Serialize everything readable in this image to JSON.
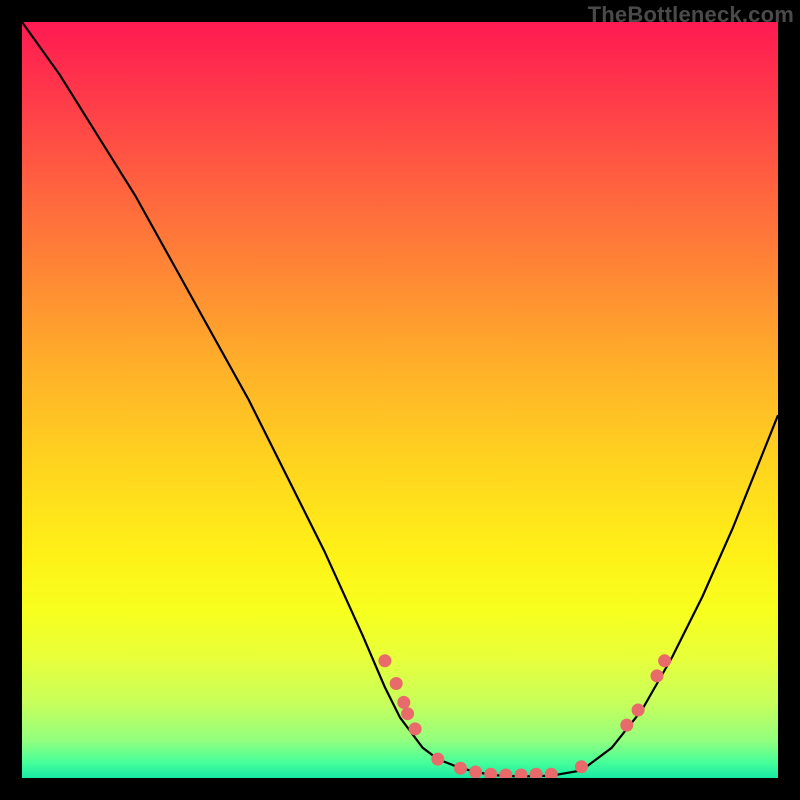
{
  "watermark": "TheBottleneck.com",
  "chart_data": {
    "type": "line",
    "title": "",
    "xlabel": "",
    "ylabel": "",
    "xlim": [
      0,
      100
    ],
    "ylim": [
      0,
      100
    ],
    "grid": false,
    "series": [
      {
        "name": "curve",
        "x": [
          0,
          5,
          10,
          15,
          20,
          25,
          30,
          35,
          40,
          45,
          48,
          50,
          53,
          55,
          58,
          62,
          66,
          70,
          74,
          78,
          82,
          86,
          90,
          94,
          98,
          100
        ],
        "y": [
          100,
          93,
          85,
          77,
          68,
          59,
          50,
          40,
          30,
          19,
          12,
          8,
          4,
          2.5,
          1.3,
          0.4,
          0.2,
          0.3,
          1,
          4,
          9,
          16,
          24,
          33,
          43,
          48
        ]
      }
    ],
    "markers": [
      {
        "x": 48.0,
        "y": 15.5
      },
      {
        "x": 49.5,
        "y": 12.5
      },
      {
        "x": 50.5,
        "y": 10.0
      },
      {
        "x": 51.0,
        "y": 8.5
      },
      {
        "x": 52.0,
        "y": 6.5
      },
      {
        "x": 55.0,
        "y": 2.5
      },
      {
        "x": 58.0,
        "y": 1.3
      },
      {
        "x": 60.0,
        "y": 0.8
      },
      {
        "x": 62.0,
        "y": 0.5
      },
      {
        "x": 64.0,
        "y": 0.4
      },
      {
        "x": 66.0,
        "y": 0.4
      },
      {
        "x": 68.0,
        "y": 0.5
      },
      {
        "x": 70.0,
        "y": 0.5
      },
      {
        "x": 74.0,
        "y": 1.5
      },
      {
        "x": 80.0,
        "y": 7.0
      },
      {
        "x": 81.5,
        "y": 9.0
      },
      {
        "x": 84.0,
        "y": 13.5
      },
      {
        "x": 85.0,
        "y": 15.5
      }
    ],
    "marker_color": "#e86a6a",
    "curve_color": "#000000"
  }
}
